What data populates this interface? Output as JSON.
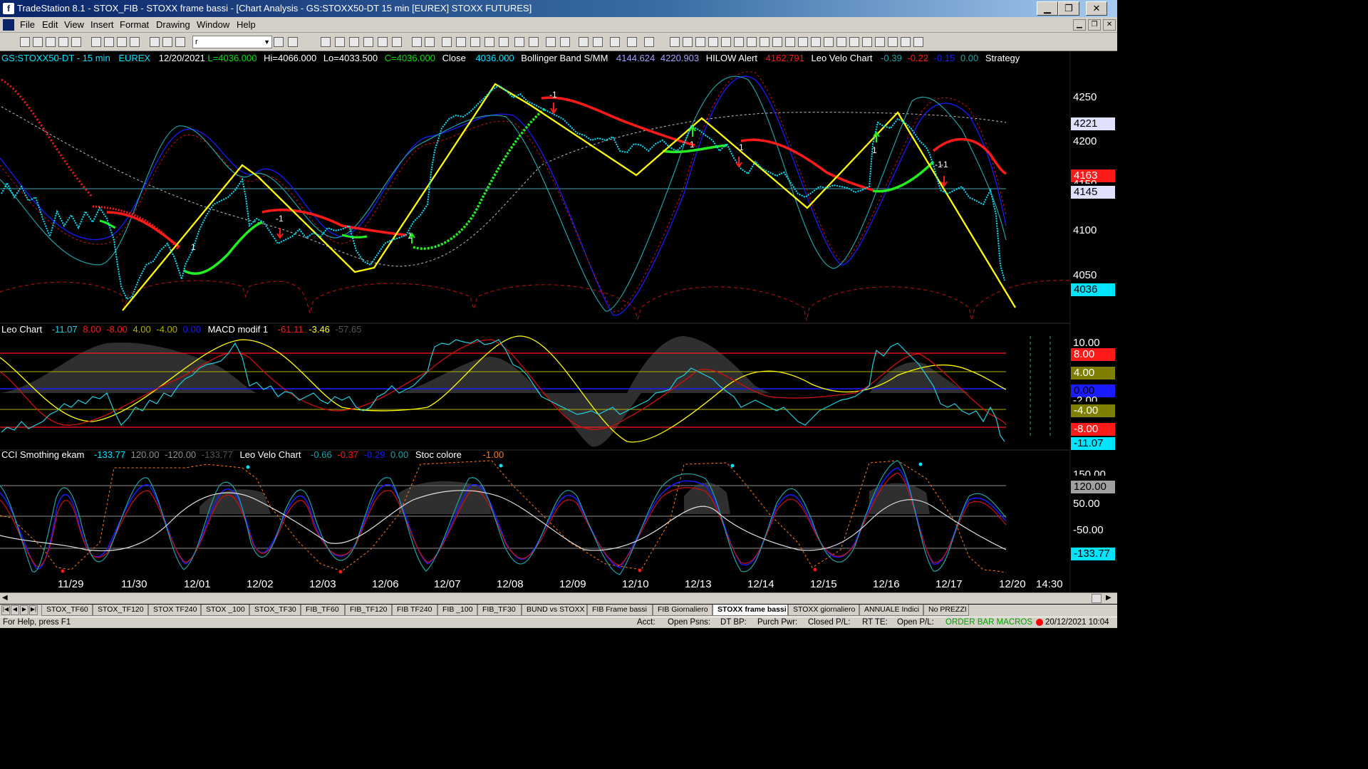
{
  "window": {
    "title": "TradeStation 8.1 - STOX_FIB - STOXX frame bassi - [Chart Analysis - GS:STOXX50-DT  15 min  [EUREX] STOXX FUTURES]",
    "minimize": "▁",
    "maximize": "❐",
    "close": "✕"
  },
  "menu": [
    "File",
    "Edit",
    "View",
    "Insert",
    "Format",
    "Drawing",
    "Window",
    "Help"
  ],
  "mdi": {
    "minimize": "▁",
    "restore": "❐",
    "close": "✕"
  },
  "toolbar": {
    "symbol_value": "r"
  },
  "price_header": {
    "symbol": "GS:STOXX50-DT - 15 min",
    "exchange": "EUREX",
    "date": "12/20/2021",
    "last": "L=4036.000",
    "high": "Hi=4066.000",
    "low": "Lo=4033.500",
    "close_c": "C=4036.000",
    "close_label": "Close",
    "close_val": "4036.000",
    "bb_label": "Bollinger Band S/MM",
    "bb_v1": "4144.624",
    "bb_v2": "4220.903",
    "hilow_label": "HILOW Alert",
    "hilow_val": "4162.791",
    "leo_label": "Leo Velo Chart",
    "leo_v1": "-0.39",
    "leo_v2": "-0.22",
    "leo_v3": "-0.15",
    "leo_v4": "0.00",
    "strategy": "Strategy"
  },
  "price_axis": {
    "labels": [
      "4250",
      "4200",
      "4100",
      "4050"
    ],
    "boxes": {
      "b4221": "4221",
      "b4163": "4163",
      "b4145": "4145",
      "b4036": "4036"
    },
    "partial": "4150"
  },
  "markers": {
    "m1": "-1",
    "m2": "1",
    "m3": "-1",
    "m4": "1",
    "m5": "-1",
    "m6": "1",
    "m7": "-1",
    "m8": "1",
    "m9": "-1"
  },
  "pane2": {
    "leo_label": "Leo Chart",
    "v1": "-11.07",
    "v2": "8.00",
    "v3": "-8.00",
    "v4": "4.00",
    "v5": "-4.00",
    "v6": "0.00",
    "macd_label": "MACD modif 1",
    "m1": "-61.11",
    "m2": "-3.46",
    "m3": "-57.65",
    "axis": {
      "a10": "10.00",
      "a8": "8.00",
      "a4": "4.00",
      "a0": "0.00",
      "am2": "-2.00",
      "am4": "-4.00",
      "am8": "-8.00",
      "am11": "-11.07"
    }
  },
  "pane3": {
    "cci_label": "CCI Smothing ekam",
    "v1": "-133.77",
    "v2": "120.00",
    "v3": "-120.00",
    "v4": "-133.77",
    "leo_label": "Leo Velo Chart",
    "l1": "-0.66",
    "l2": "-0.37",
    "l3": "-0.29",
    "l4": "0.00",
    "stoc_label": "Stoc colore",
    "s1": "-1.00",
    "axis": {
      "a150": "150.00",
      "a120": "120.00",
      "a50": "50.00",
      "am50": "-50.00",
      "am133": "-133.77"
    }
  },
  "dates": [
    "11/29",
    "11/30",
    "12/01",
    "12/02",
    "12/03",
    "12/06",
    "12/07",
    "12/08",
    "12/09",
    "12/10",
    "12/13",
    "12/14",
    "12/15",
    "12/16",
    "12/17",
    "12/20",
    "14:30"
  ],
  "tabs": [
    "STOX_TF60",
    "STOX_TF120",
    "STOX TF240",
    "STOX _100",
    "STOX_TF30",
    "FIB_TF60",
    "FIB_TF120",
    "FIB TF240",
    "FIB _100",
    "FIB_TF30",
    "BUND vs STOXX",
    "FIB Frame bassi",
    "FIB Giornaliero",
    "STOXX frame bassi",
    "STOXX giornaliero",
    "ANNUALE Indici",
    "No PREZZI"
  ],
  "status": {
    "help": "For Help, press F1",
    "acct": "Acct:",
    "open_psns": "Open Psns:",
    "dt_bp": "DT BP:",
    "purch_pwr": "Purch Pwr:",
    "closed_pl": "Closed P/L:",
    "rt_te": "RT TE:",
    "open_pl": "Open P/L:",
    "macros": "ORDER BAR  MACROS",
    "datetime": "20/12/2021 10:04"
  },
  "colors": {
    "cyan": "#00e5ff",
    "yellow": "#ffff00",
    "red": "#ff1a1a",
    "green": "#22ee22",
    "navy": "#1a1aff",
    "teal": "#1fa3a3",
    "label_white": "#ffffff",
    "accent_green": "#00b000"
  }
}
